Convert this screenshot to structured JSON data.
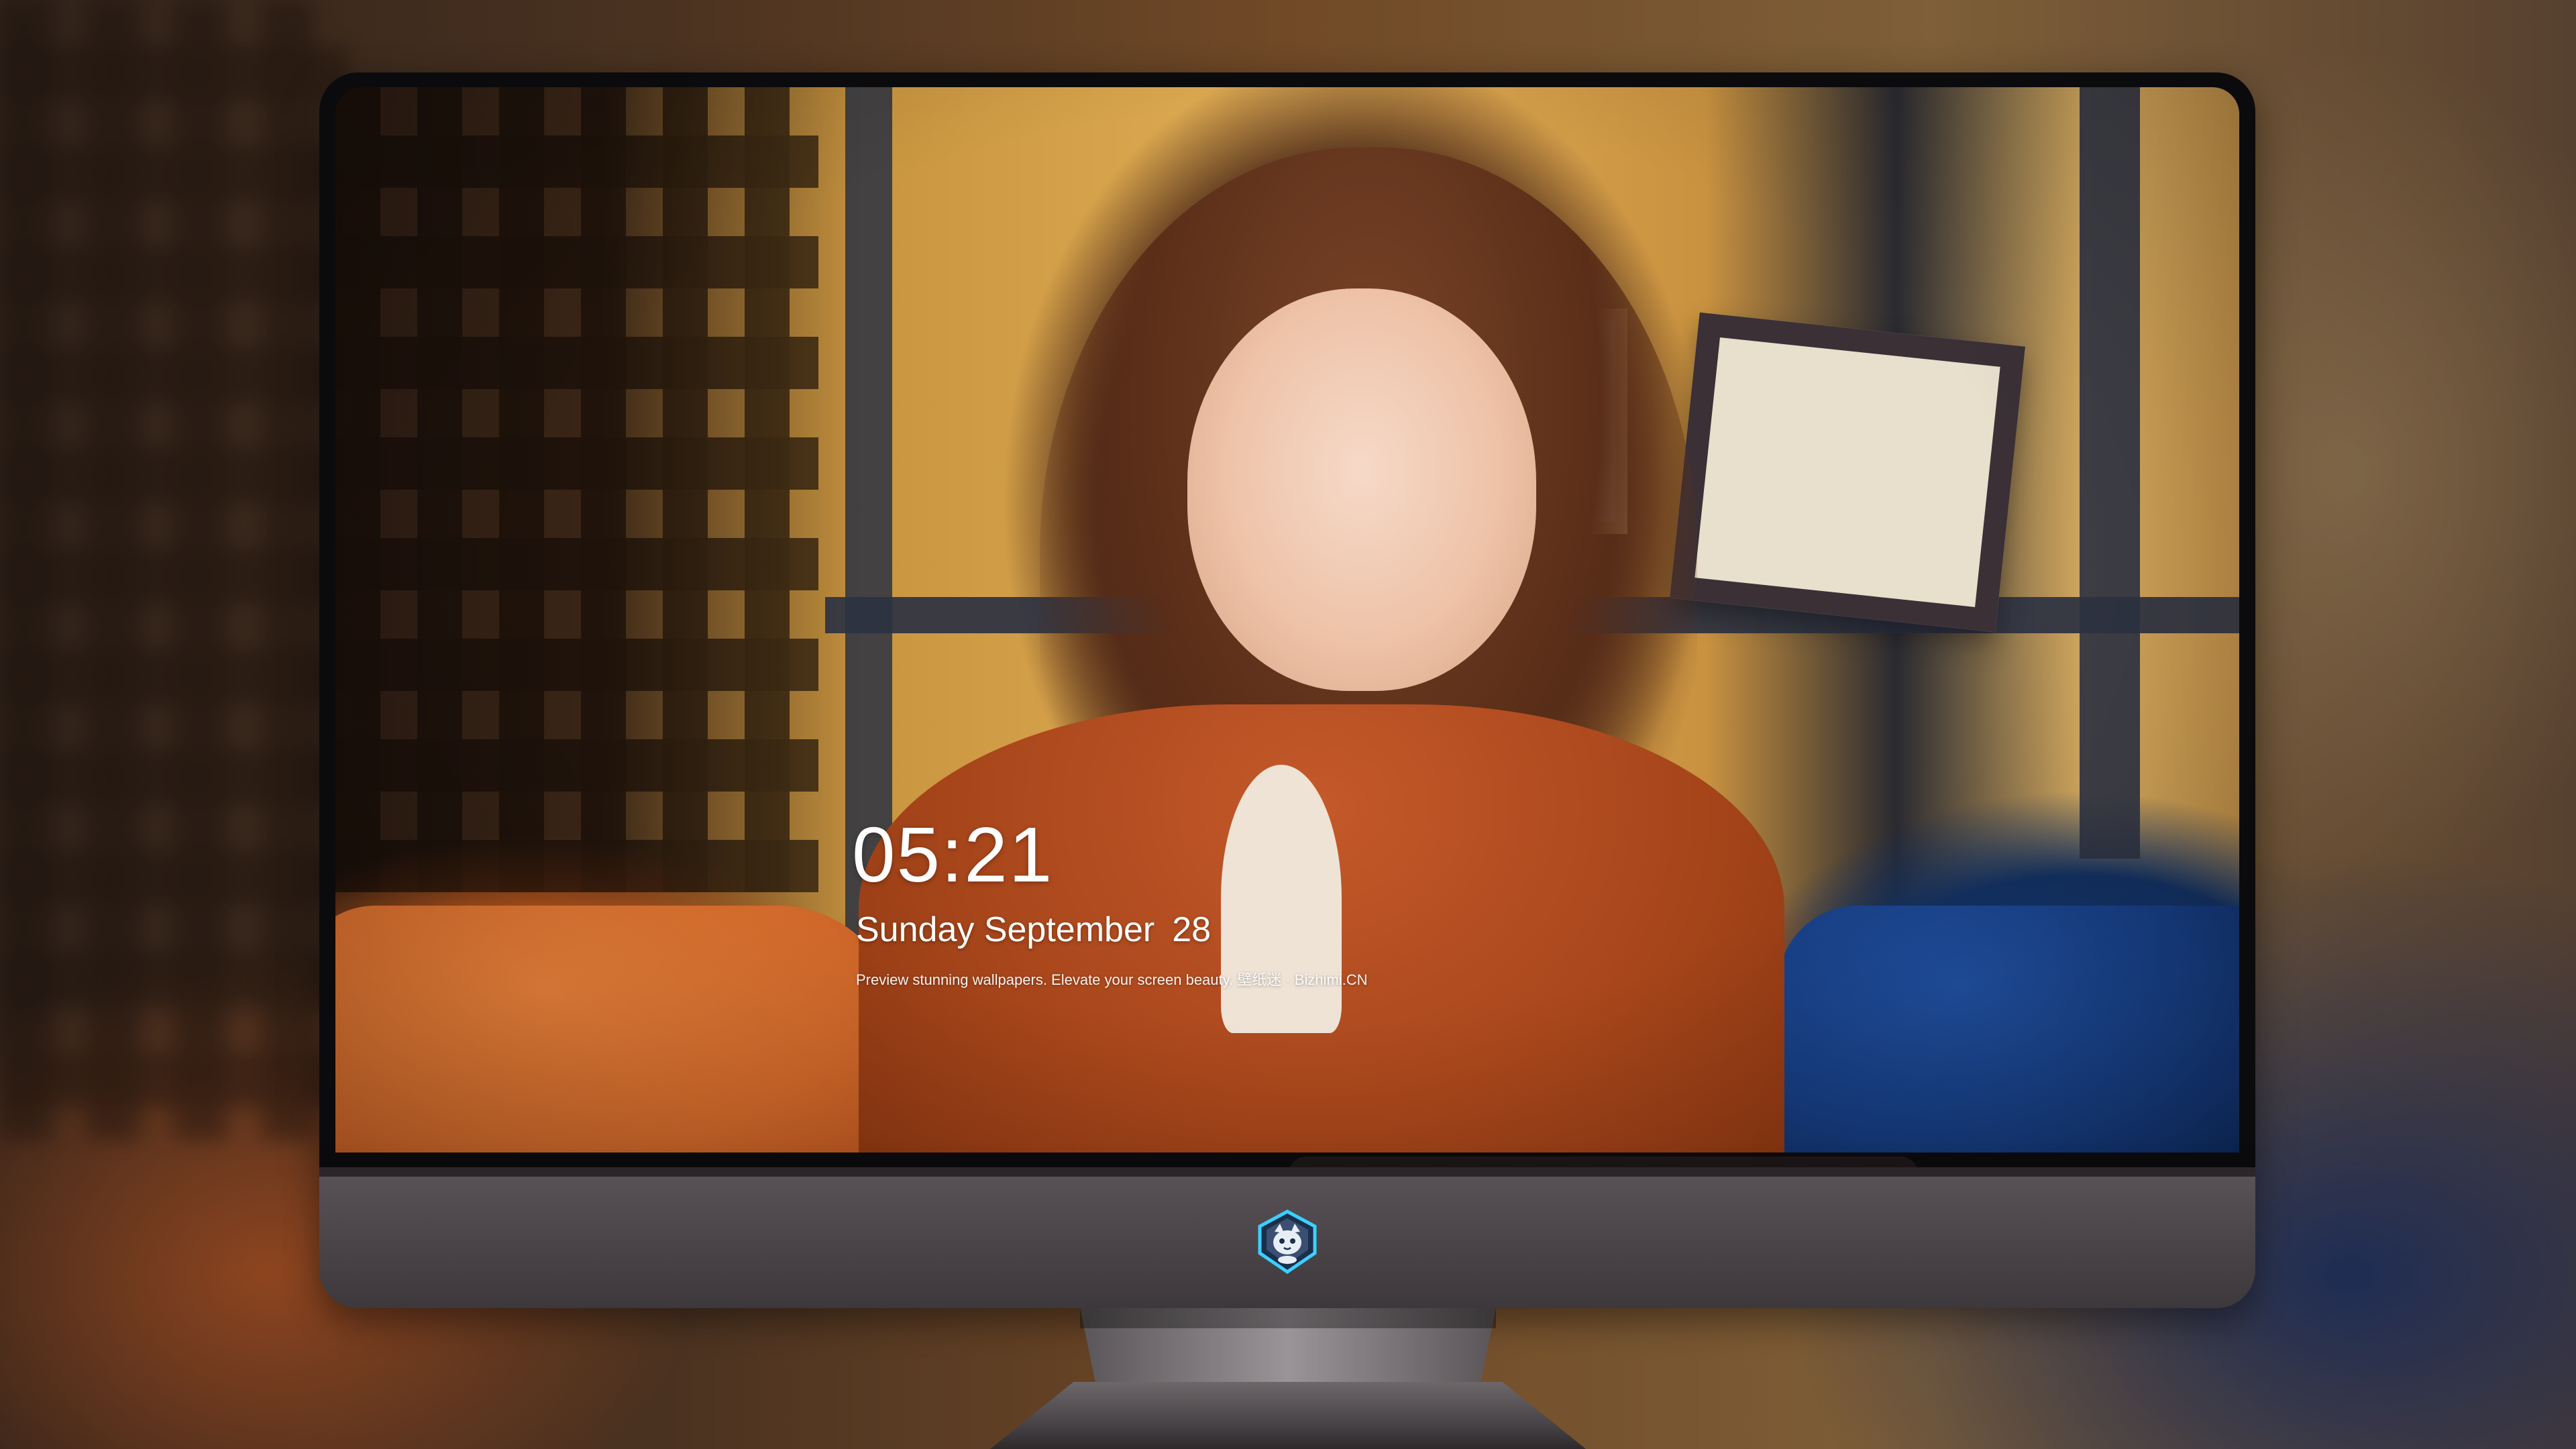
{
  "lockscreen": {
    "time": "05:21",
    "weekday": "Sunday",
    "month": "September",
    "day": "28",
    "tagline": "Preview stunning wallpapers. Elevate your screen beauty. 壁纸迷 · Bizhimi.CN"
  },
  "dock": {
    "apps": [
      {
        "name": "messages-icon"
      },
      {
        "name": "weather-icon"
      },
      {
        "name": "clock-icon"
      },
      {
        "name": "preview-icon"
      },
      {
        "name": "clips-icon"
      },
      {
        "name": "notes-icon"
      },
      {
        "name": "photos-icon"
      }
    ],
    "apps_right": [
      {
        "name": "music-icon"
      },
      {
        "name": "app-store-icon"
      },
      {
        "name": "camera-icon"
      }
    ]
  },
  "colors": {
    "messages": "#21c33a",
    "weather": "#1b6ee6",
    "music": "#c041e6",
    "app_store": "#1264e8",
    "bezel": "#0b0b0d",
    "chin": "#4a4448"
  },
  "chin": {
    "logo_icon": "shield-cat-logo-icon"
  }
}
